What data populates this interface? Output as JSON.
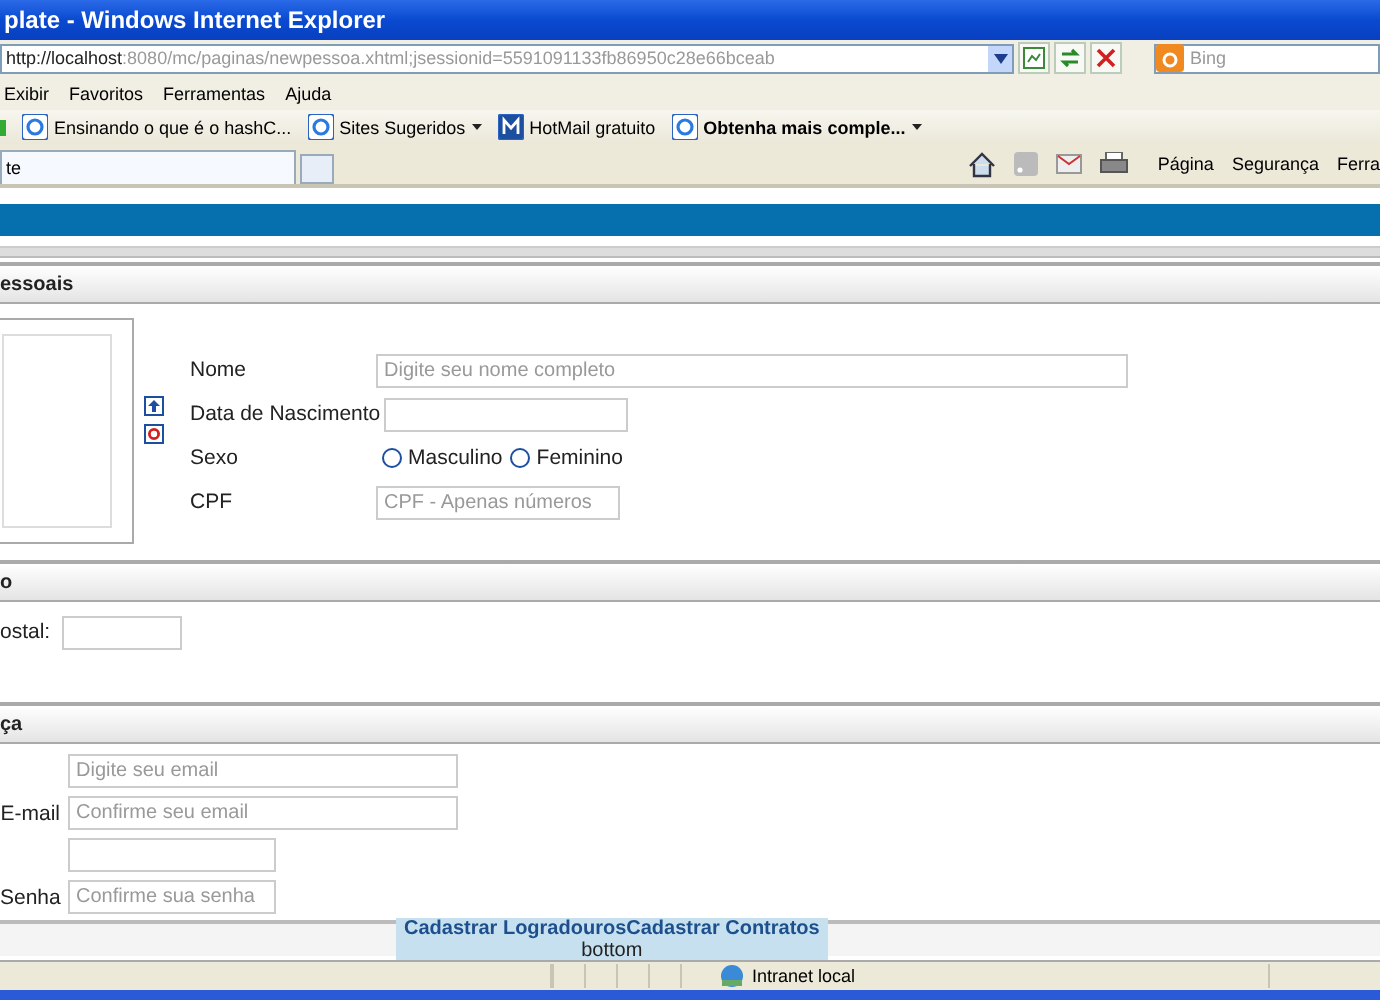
{
  "window": {
    "title": "plate - Windows Internet Explorer"
  },
  "address_bar": {
    "url_host": "http://localhost",
    "url_rest": ":8080/mc/paginas/newpessoa.xhtml;jsessionid=5591091133fb86950c28e66bceab",
    "search_placeholder": "Bing"
  },
  "menu": [
    "Exibir",
    "Favoritos",
    "Ferramentas",
    "Ajuda"
  ],
  "favorites": [
    {
      "label": "Ensinando o que é o hashC...",
      "bold": false,
      "dropdown": false
    },
    {
      "label": "Sites Sugeridos",
      "bold": false,
      "dropdown": true
    },
    {
      "label": "HotMail gratuito",
      "bold": false,
      "dropdown": false
    },
    {
      "label": "Obtenha mais comple...",
      "bold": true,
      "dropdown": true
    }
  ],
  "tabs": [
    {
      "label": "te",
      "selected": true
    }
  ],
  "command_bar": [
    "Página",
    "Segurança",
    "Ferra"
  ],
  "sections": [
    {
      "title": "essoais",
      "kind": "personal"
    },
    {
      "title": "o",
      "kind": "address"
    },
    {
      "title": "ça",
      "kind": "security"
    }
  ],
  "personal": {
    "fields": [
      {
        "label": "Nome",
        "kind": "text",
        "placeholder": "Digite seu nome completo"
      },
      {
        "label": "Data de Nascimento",
        "kind": "short"
      },
      {
        "label": "Sexo",
        "kind": "radio",
        "options": [
          {
            "label": "Masculino",
            "selected": false
          },
          {
            "label": "Feminino",
            "selected": false
          }
        ]
      },
      {
        "label": "CPF",
        "kind": "short",
        "placeholder": "CPF - Apenas números"
      }
    ]
  },
  "address": {
    "postal_label": "ostal:"
  },
  "security": {
    "fields": [
      {
        "kind": "long",
        "placeholder": "Digite seu email"
      },
      {
        "label": "E-mail",
        "kind": "long",
        "placeholder": "Confirme seu email"
      },
      {
        "kind": "short"
      },
      {
        "label": "Senha",
        "kind": "short",
        "placeholder": "Confirme sua senha"
      }
    ]
  },
  "footer": {
    "links": [
      "Cadastrar Logradouros",
      "Cadastrar Contratos"
    ],
    "text": "bottom"
  },
  "status_bar": {
    "zone": "Intranet local"
  }
}
